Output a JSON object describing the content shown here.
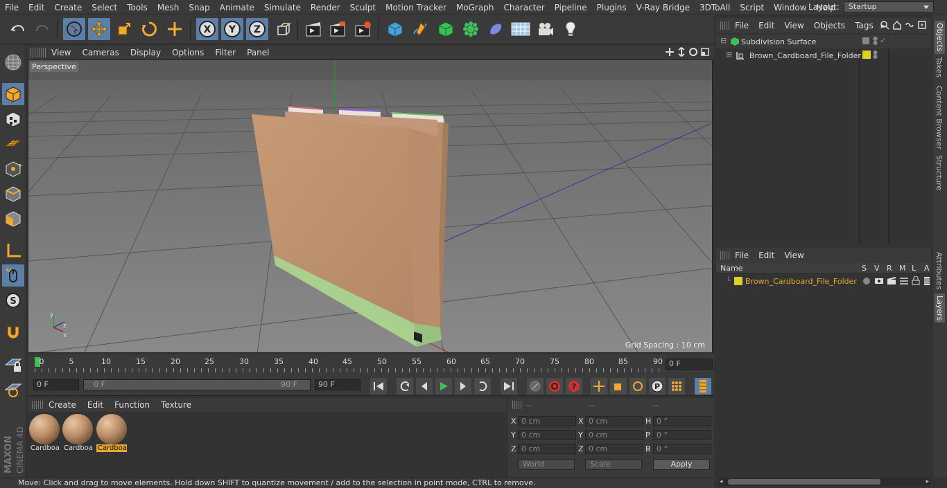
{
  "menubar": {
    "items": [
      "File",
      "Edit",
      "Create",
      "Select",
      "Tools",
      "Mesh",
      "Snap",
      "Animate",
      "Simulate",
      "Render",
      "Sculpt",
      "Motion Tracker",
      "MoGraph",
      "Character",
      "Pipeline",
      "Plugins",
      "V-Ray Bridge",
      "3DToAll",
      "Script",
      "Window",
      "Help"
    ],
    "layout_label": "Layout:",
    "layout_value": "Startup"
  },
  "viewport": {
    "menu": [
      "View",
      "Cameras",
      "Display",
      "Options",
      "Filter",
      "Panel"
    ],
    "camera_label": "Perspective",
    "grid_spacing": "Grid Spacing : 10 cm"
  },
  "timeline": {
    "ticks": [
      "0",
      "5",
      "10",
      "15",
      "20",
      "25",
      "30",
      "35",
      "40",
      "45",
      "50",
      "55",
      "60",
      "65",
      "70",
      "75",
      "80",
      "85",
      "90"
    ],
    "current_frame": "0 F"
  },
  "transport": {
    "start_field": "0 F",
    "range_start": "0 F",
    "range_end": "90 F",
    "end_field": "90 F"
  },
  "materials": {
    "menu": [
      "Create",
      "Edit",
      "Function",
      "Texture"
    ],
    "items": [
      "Cardboa",
      "Cardboa",
      "Cardboa"
    ]
  },
  "coords": {
    "headers": [
      "--",
      "--",
      "--"
    ],
    "rows": [
      {
        "a": "X",
        "av": "0 cm",
        "b": "X",
        "bv": "0 cm",
        "c": "H",
        "cv": "0 °"
      },
      {
        "a": "Y",
        "av": "0 cm",
        "b": "Y",
        "bv": "0 cm",
        "c": "P",
        "cv": "0 °"
      },
      {
        "a": "Z",
        "av": "0 cm",
        "b": "Z",
        "bv": "0 cm",
        "c": "B",
        "cv": "0 °"
      }
    ],
    "mode1": "World",
    "mode2": "Scale",
    "apply": "Apply"
  },
  "objects": {
    "menu": [
      "File",
      "Edit",
      "View",
      "Objects",
      "Tags"
    ],
    "items": [
      {
        "name": "Subdivision Surface"
      },
      {
        "name": "Brown_Cardboard_File_Folder"
      }
    ]
  },
  "layers": {
    "menu": [
      "File",
      "Edit",
      "View"
    ],
    "col_name": "Name",
    "cols": [
      "S",
      "V",
      "R",
      "M",
      "L",
      "A"
    ],
    "items": [
      {
        "name": "Brown_Cardboard_File_Folder"
      }
    ]
  },
  "right_tabs": [
    "Objects",
    "Takes",
    "Content Browser",
    "Structure",
    "Attributes",
    "Layers"
  ],
  "brand": {
    "top": "MAXON",
    "bottom": "CINEMA 4D"
  },
  "status": "Move: Click and drag to move elements. Hold down SHIFT to quantize movement / add to the selection in point mode, CTRL to remove.",
  "colors": {
    "accent": "#5b7fa6",
    "layer_yellow": "#e0d020",
    "active_orange": "#e4a72c"
  }
}
